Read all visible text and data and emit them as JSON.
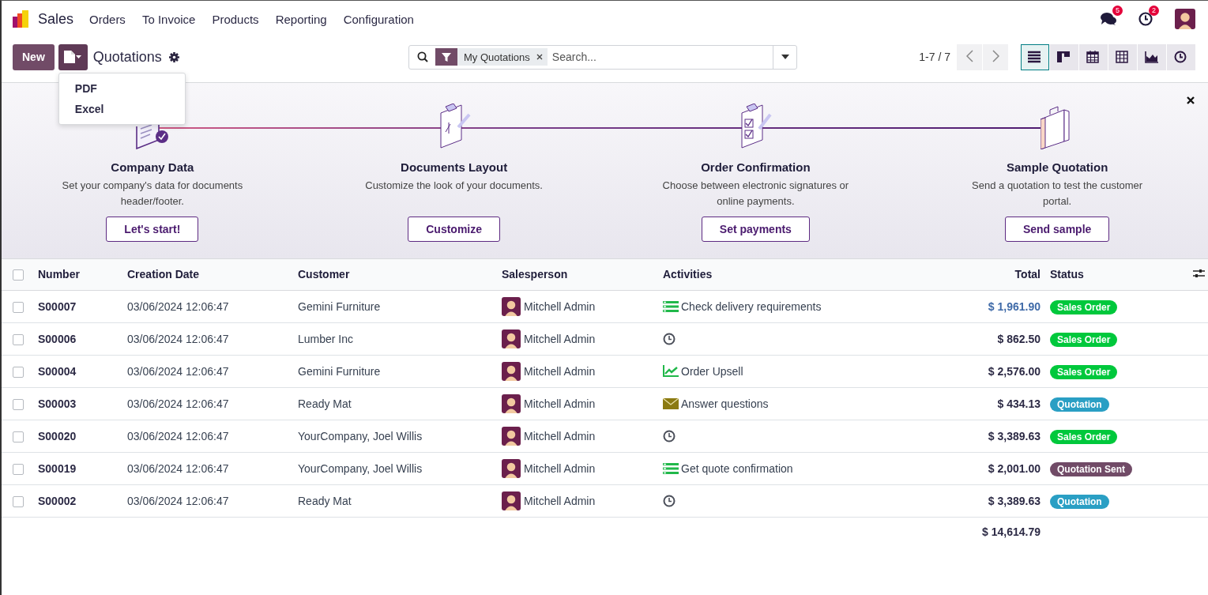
{
  "navbar": {
    "app_name": "Sales",
    "menu": [
      "Orders",
      "To Invoice",
      "Products",
      "Reporting",
      "Configuration"
    ],
    "messages_badge": "5",
    "activities_badge": "2"
  },
  "control_panel": {
    "new_button": "New",
    "title": "Quotations",
    "export_menu": {
      "expanded": true,
      "items": [
        "PDF",
        "Excel"
      ]
    },
    "search": {
      "facet": "My Quotations",
      "placeholder": "Search..."
    },
    "pager": "1-7 / 7",
    "views": [
      {
        "kind": "list",
        "selected": true
      },
      {
        "kind": "kanban",
        "selected": false
      },
      {
        "kind": "calendar",
        "selected": false
      },
      {
        "kind": "pivot",
        "selected": false
      },
      {
        "kind": "graph",
        "selected": false
      },
      {
        "kind": "activity",
        "selected": false
      }
    ]
  },
  "onboarding": {
    "steps": [
      {
        "kind": "company",
        "done": true,
        "title": "Company Data",
        "description": "Set your company's data for documents header/footer.",
        "button": "Let's start!"
      },
      {
        "kind": "layout",
        "done": false,
        "title": "Documents Layout",
        "description": "Customize the look of your documents.",
        "button": "Customize"
      },
      {
        "kind": "confirmation",
        "done": false,
        "title": "Order Confirmation",
        "description": "Choose between electronic signatures or online payments.",
        "button": "Set payments"
      },
      {
        "kind": "sample",
        "done": false,
        "title": "Sample Quotation",
        "description": "Send a quotation to test the customer portal.",
        "button": "Send sample"
      }
    ]
  },
  "table": {
    "select_all_checked": false,
    "columns": [
      "Number",
      "Creation Date",
      "Customer",
      "Salesperson",
      "Activities",
      "Total",
      "Status"
    ],
    "rows": [
      {
        "checked": false,
        "number": "S00007",
        "date": "03/06/2024 12:06:47",
        "customer": "Gemini Furniture",
        "salesperson": "Mitchell Admin",
        "activity": {
          "kind": "todo",
          "text": "Check delivery requirements"
        },
        "total": "$ 1,961.90",
        "total_highlighted": true,
        "status": {
          "label": "Sales Order",
          "color": "#00c83c"
        }
      },
      {
        "checked": false,
        "number": "S00006",
        "date": "03/06/2024 12:06:47",
        "customer": "Lumber Inc",
        "salesperson": "Mitchell Admin",
        "activity": {
          "kind": "none"
        },
        "total": "$ 862.50",
        "total_highlighted": false,
        "status": {
          "label": "Sales Order",
          "color": "#00c83c"
        }
      },
      {
        "checked": false,
        "number": "S00004",
        "date": "03/06/2024 12:06:47",
        "customer": "Gemini Furniture",
        "salesperson": "Mitchell Admin",
        "activity": {
          "kind": "upsell",
          "text": "Order Upsell"
        },
        "total": "$ 2,576.00",
        "total_highlighted": false,
        "status": {
          "label": "Sales Order",
          "color": "#00c83c"
        }
      },
      {
        "checked": false,
        "number": "S00003",
        "date": "03/06/2024 12:06:47",
        "customer": "Ready Mat",
        "salesperson": "Mitchell Admin",
        "activity": {
          "kind": "email",
          "text": "Answer questions"
        },
        "total": "$ 434.13",
        "total_highlighted": false,
        "status": {
          "label": "Quotation",
          "color": "#2a9fc4"
        }
      },
      {
        "checked": false,
        "number": "S00020",
        "date": "03/06/2024 12:06:47",
        "customer": "YourCompany, Joel Willis",
        "salesperson": "Mitchell Admin",
        "activity": {
          "kind": "none"
        },
        "total": "$ 3,389.63",
        "total_highlighted": false,
        "status": {
          "label": "Sales Order",
          "color": "#00c83c"
        }
      },
      {
        "checked": false,
        "number": "S00019",
        "date": "03/06/2024 12:06:47",
        "customer": "YourCompany, Joel Willis",
        "salesperson": "Mitchell Admin",
        "activity": {
          "kind": "todo",
          "text": "Get quote confirmation"
        },
        "total": "$ 2,001.00",
        "total_highlighted": false,
        "status": {
          "label": "Quotation Sent",
          "color": "#714b67"
        }
      },
      {
        "checked": false,
        "number": "S00002",
        "date": "03/06/2024 12:06:47",
        "customer": "Ready Mat",
        "salesperson": "Mitchell Admin",
        "activity": {
          "kind": "none"
        },
        "total": "$ 3,389.63",
        "total_highlighted": false,
        "status": {
          "label": "Quotation",
          "color": "#2a9fc4"
        }
      }
    ],
    "grand_total": "$ 14,614.79"
  }
}
